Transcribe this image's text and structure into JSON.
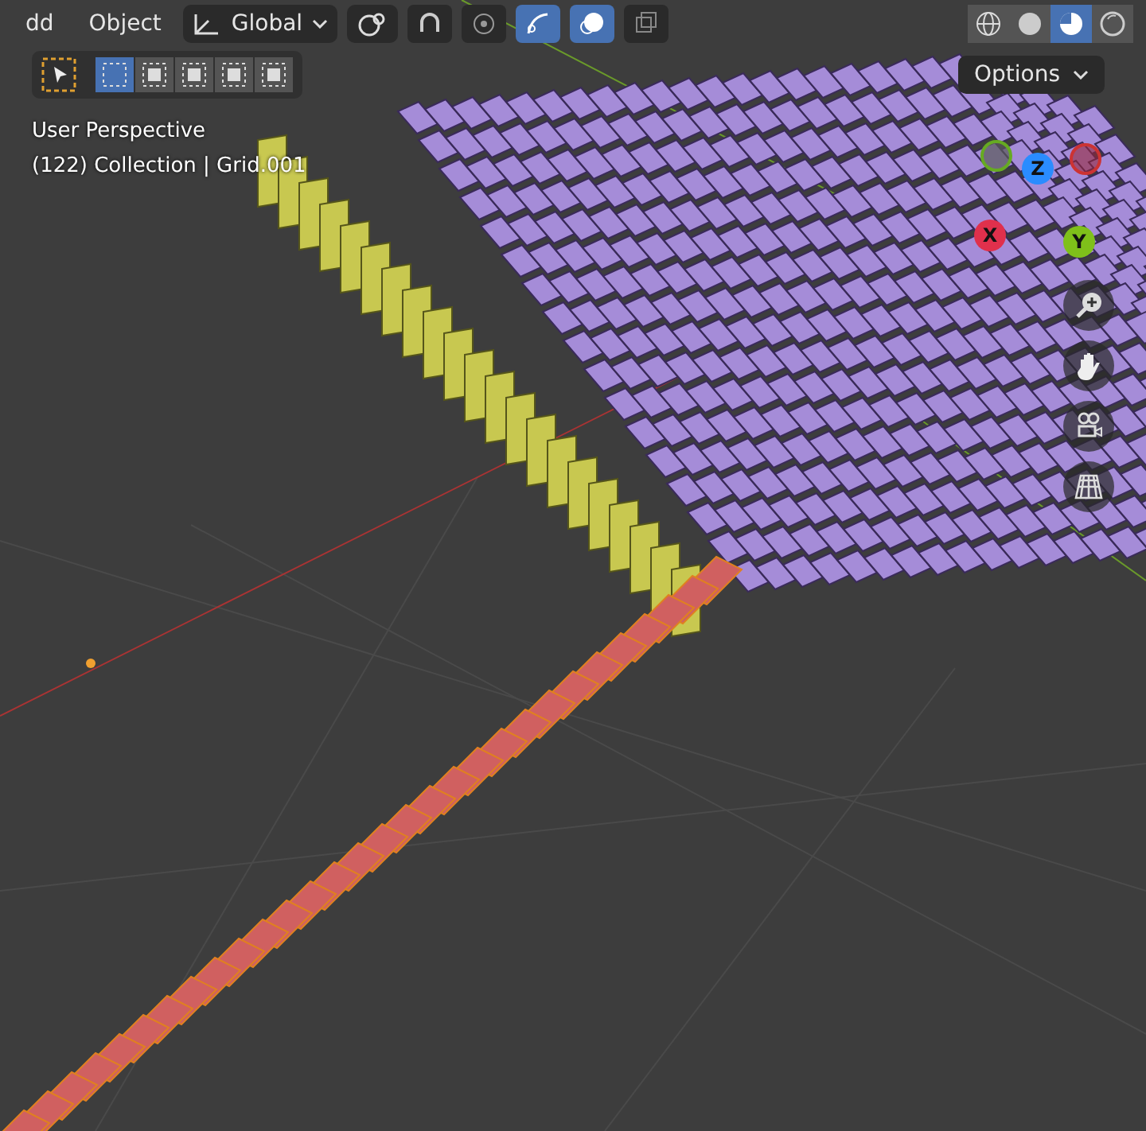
{
  "header": {
    "menus": [
      "dd",
      "Object"
    ],
    "orientation": "Global",
    "toggles": [
      {
        "kind": "snap",
        "on": false
      },
      {
        "kind": "proportional",
        "on": false
      },
      {
        "kind": "gizmo",
        "on": true
      },
      {
        "kind": "overlay",
        "on": true
      },
      {
        "kind": "xray",
        "on": false
      }
    ],
    "shading": [
      {
        "kind": "wireframe",
        "selected": false
      },
      {
        "kind": "solid",
        "selected": false
      },
      {
        "kind": "material",
        "selected": true
      },
      {
        "kind": "rendered",
        "selected": false
      }
    ]
  },
  "toolbar": {
    "select_modes": [
      {
        "selected": true
      },
      {
        "selected": false
      },
      {
        "selected": false
      },
      {
        "selected": false
      },
      {
        "selected": false
      }
    ],
    "options": "Options"
  },
  "viewport": {
    "view_name": "User Perspective",
    "context": "(122) Collection | Grid.001",
    "axes": [
      "X",
      "Y",
      "Z"
    ]
  }
}
